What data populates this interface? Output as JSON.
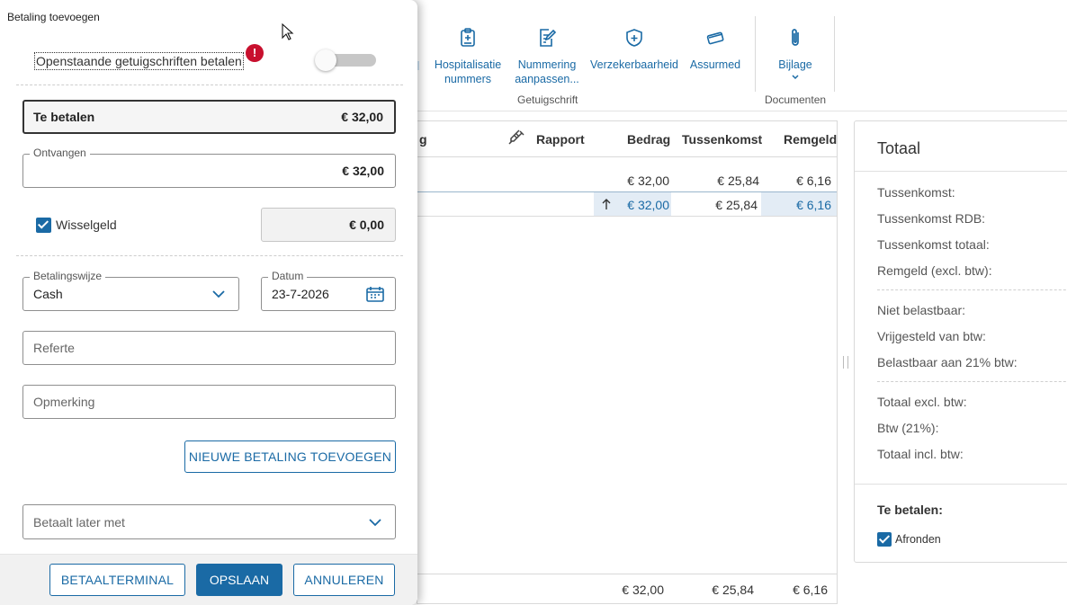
{
  "ribbon": {
    "buttons": [
      {
        "label": "Hospitalisatie\nnummers",
        "icon": "hospital-badge-icon"
      },
      {
        "label": "Nummering\naanpassen...",
        "icon": "edit-document-icon"
      },
      {
        "label": "Verzekerbaarheid",
        "icon": "shield-plus-icon"
      },
      {
        "label": "Assurmed",
        "icon": "card-icon"
      },
      {
        "label": "Bijlage",
        "icon": "paperclip-icon"
      }
    ],
    "groups": {
      "getuigschrift": "Getuigschrift",
      "documenten": "Documenten"
    }
  },
  "grid": {
    "headers": {
      "partial": "g",
      "rapport": "Rapport",
      "bedrag": "Bedrag",
      "tussenkomst": "Tussenkomst",
      "remgeld": "Remgeld"
    },
    "rows": [
      {
        "bedrag": "€ 32,00",
        "tussenkomst": "€ 25,84",
        "remgeld": "€ 6,16"
      },
      {
        "bedrag": "€ 32,00",
        "tussenkomst": "€ 25,84",
        "remgeld": "€ 6,16"
      }
    ],
    "footer": {
      "bedrag": "€ 32,00",
      "tussenkomst": "€ 25,84",
      "remgeld": "€ 6,16"
    }
  },
  "totals": {
    "title": "Totaal",
    "lines1": [
      "Tussenkomst:",
      "Tussenkomst RDB:",
      "Tussenkomst totaal:",
      "Remgeld (excl. btw):"
    ],
    "lines2": [
      "Niet belastbaar:",
      "Vrijgesteld van btw:",
      "Belastbaar aan 21% btw:"
    ],
    "lines3": [
      "Totaal excl. btw:",
      "Btw (21%):",
      "Totaal incl. btw:"
    ],
    "te_betalen": "Te betalen:",
    "afronden": "Afronden",
    "afronden_checked": true
  },
  "dialog": {
    "title": "Betaling toevoegen",
    "switch_label": "Openstaande getuigschriften betalen",
    "switch_on": false,
    "warning": "!",
    "te_betalen_label": "Te betalen",
    "te_betalen_value": "€ 32,00",
    "ontvangen_label": "Ontvangen",
    "ontvangen_value": "€ 32,00",
    "wisselgeld_label": "Wisselgeld",
    "wisselgeld_checked": true,
    "wisselgeld_value": "€ 0,00",
    "betalingswijze_label": "Betalingswijze",
    "betalingswijze_value": "Cash",
    "datum_label": "Datum",
    "datum_value": "23-7-2026",
    "referte_placeholder": "Referte",
    "opmerking_placeholder": "Opmerking",
    "nieuwe_betaling": "NIEUWE BETALING TOEVOEGEN",
    "betaalt_later_placeholder": "Betaalt later met",
    "betaalterminal": "BETAALTERMINAL",
    "opslaan": "OPSLAAN",
    "annuleren": "ANNULEREN"
  },
  "colors": {
    "accent": "#1a6aa5",
    "warning": "#c8102e",
    "highlight": "#e3ecf5"
  }
}
